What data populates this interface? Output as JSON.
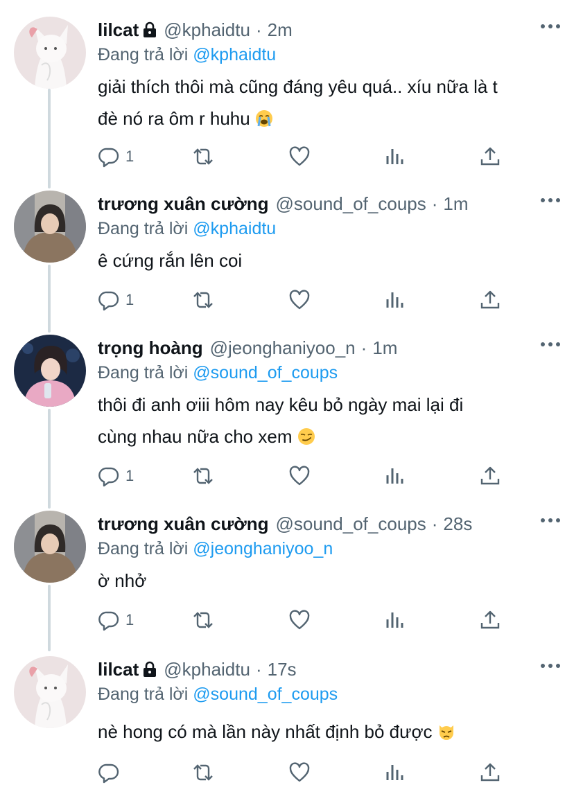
{
  "reply_prefix": "Đang trả lời",
  "tweets": [
    {
      "name": "lilcat",
      "locked": true,
      "handle": "@kphaidtu",
      "separator": "·",
      "time": "2m",
      "reply_to": "@kphaidtu",
      "text_lines": [
        "giải thích thôi mà cũng đáng yêu quá.. xíu nữa là t",
        "đè nó ra ôm r huhu"
      ],
      "emoji": "loudly-crying-face-emoji",
      "reply_count": "1"
    },
    {
      "name": "trương xuân cường",
      "locked": false,
      "handle": "@sound_of_coups",
      "separator": "·",
      "time": "1m",
      "reply_to": "@kphaidtu",
      "text_lines": [
        "ê cứng rắn lên coi"
      ],
      "emoji": "",
      "reply_count": "1"
    },
    {
      "name": "trọng hoàng",
      "locked": false,
      "handle": "@jeonghaniyoo_n",
      "separator": "·",
      "time": "1m",
      "reply_to": "@sound_of_coups",
      "text_lines": [
        "thôi đi anh ơiii hôm nay kêu bỏ ngày mai lại đi",
        "cùng nhau nữa cho xem"
      ],
      "emoji": "smirking-face-emoji",
      "reply_count": "1"
    },
    {
      "name": "trương xuân cường",
      "locked": false,
      "handle": "@sound_of_coups",
      "separator": "·",
      "time": "28s",
      "reply_to": "@jeonghaniyoo_n",
      "text_lines": [
        "ờ nhở"
      ],
      "emoji": "",
      "reply_count": "1"
    },
    {
      "name": "lilcat",
      "locked": true,
      "handle": "@kphaidtu",
      "separator": "·",
      "time": "17s",
      "reply_to": "@sound_of_coups",
      "text_lines": [
        "nè hong có mà lần này nhất định bỏ được"
      ],
      "emoji": "pouting-cat-emoji",
      "reply_count": ""
    }
  ],
  "colors": {
    "text": "#0f1419",
    "secondary": "#536471",
    "link": "#1d9bf0",
    "thread_line": "#cfd9de"
  }
}
